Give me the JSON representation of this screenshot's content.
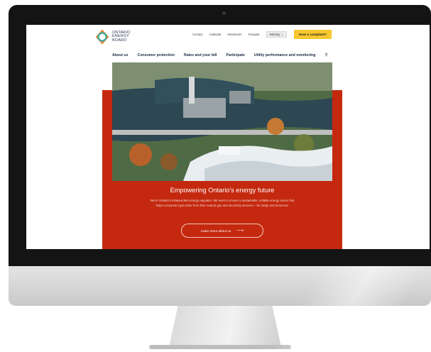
{
  "brand": {
    "logo_text": "ONTARIO\nENERGY\nBOARD",
    "colors": {
      "teal": "#3aa8a0",
      "orange": "#e9852c",
      "navy": "#2b3a55"
    }
  },
  "utility_nav": {
    "links": [
      "Contact",
      "Calendar",
      "Newsroom",
      "Français"
    ],
    "industry_label": "Industry",
    "complaint_label": "Have a complaint?",
    "complaint_color": "#f7c72f"
  },
  "main_nav": {
    "items": [
      "About us",
      "Consumer protection",
      "Rates and your bill",
      "Participate",
      "Utility performance and monitoring"
    ],
    "search_icon": "search-icon"
  },
  "hero": {
    "band_color": "#c4290f",
    "title": "Empowering Ontario's energy future",
    "body": "We're Ontario's independent energy regulator. We work to ensure a sustainable, reliable energy sector that helps consumers get value from their natural gas and electricity services – for today and tomorrow.",
    "cta_label": "Learn more about us",
    "cta_arrow": "⟶"
  }
}
